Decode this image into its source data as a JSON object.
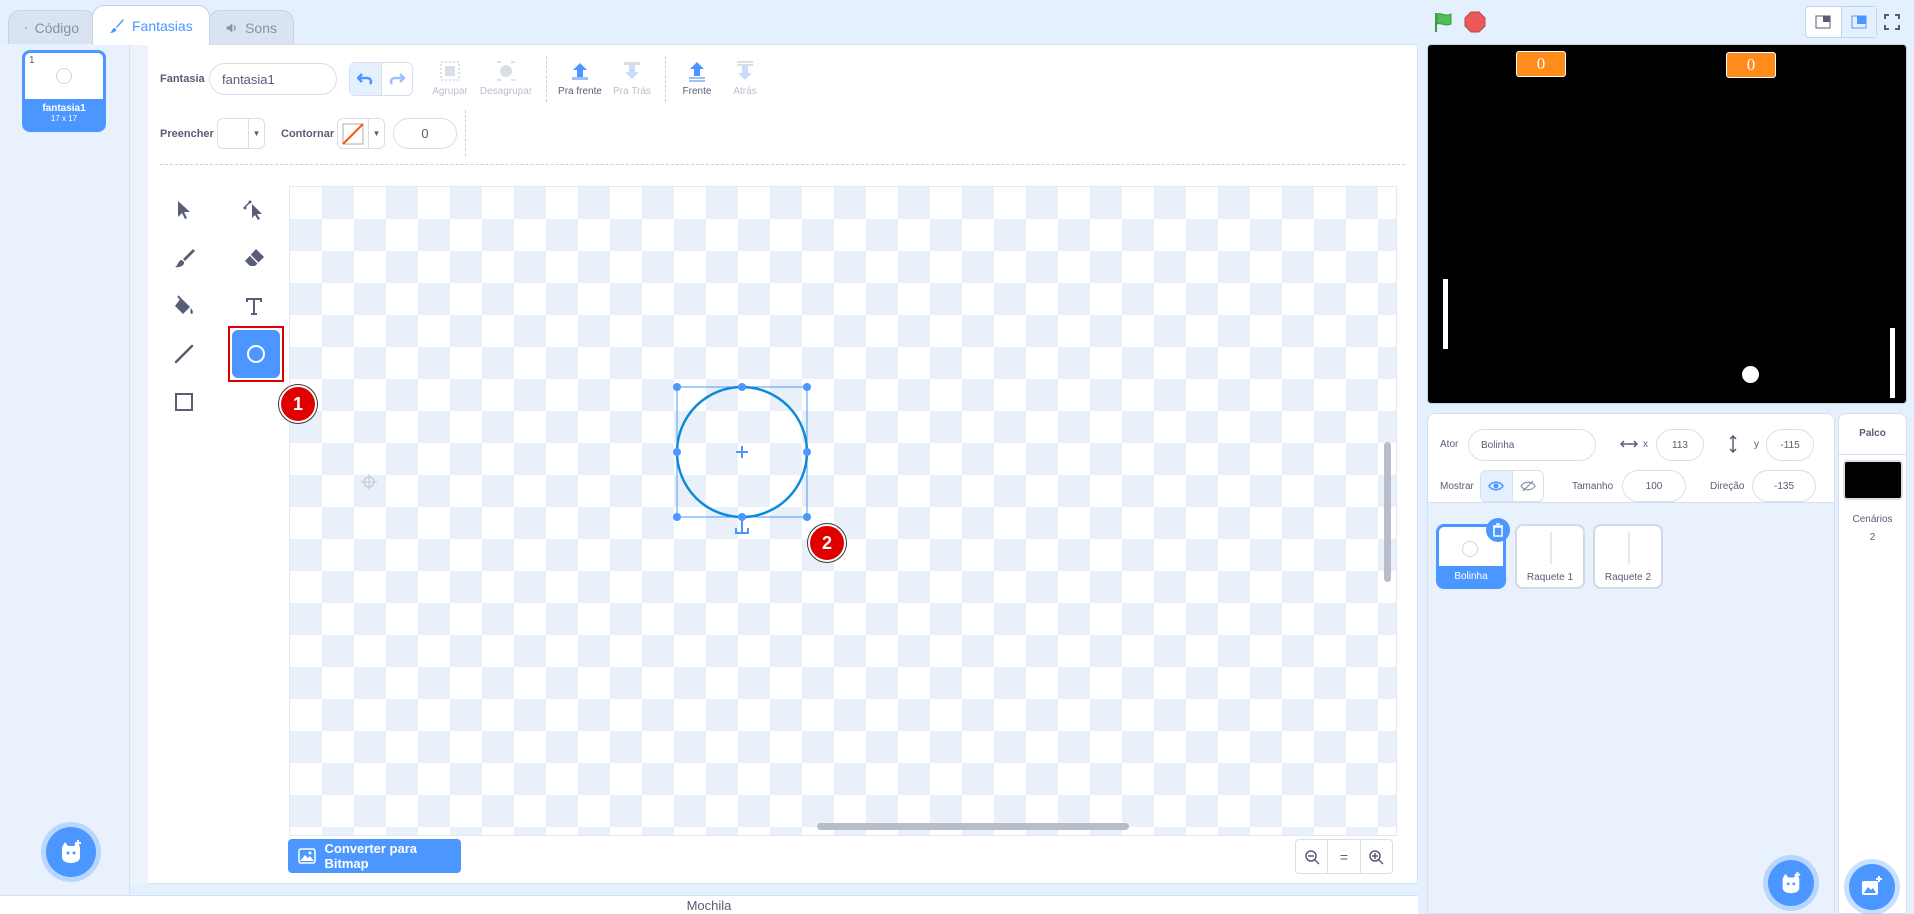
{
  "tabs": {
    "code": "Código",
    "costumes": "Fantasias",
    "sounds": "Sons"
  },
  "costume_list": {
    "items": [
      {
        "number": "1",
        "name": "fantasia1",
        "size": "17 x 17"
      }
    ]
  },
  "toolbar": {
    "costume_label": "Fantasia",
    "costume_name": "fantasia1",
    "group": "Agrupar",
    "ungroup": "Desagrupar",
    "forward": "Pra frente",
    "backward": "Pra Trás",
    "front": "Frente",
    "back": "Atrás",
    "fill_label": "Preencher",
    "outline_label": "Contornar",
    "outline_width": "0"
  },
  "tools": {
    "selected": "circle"
  },
  "markers": {
    "m1": "1",
    "m2": "2"
  },
  "canvas": {
    "convert_button": "Converter para Bitmap",
    "zoom_reset": "="
  },
  "backpack": "Mochila",
  "stage": {
    "score_left": "0",
    "score_right": "0"
  },
  "sprite_info": {
    "sprite_label": "Ator",
    "sprite_name": "Bolinha",
    "x_label": "x",
    "x_value": "113",
    "y_label": "y",
    "y_value": "-115",
    "show_label": "Mostrar",
    "size_label": "Tamanho",
    "size_value": "100",
    "direction_label": "Direção",
    "direction_value": "-135"
  },
  "sprites": [
    {
      "name": "Bolinha"
    },
    {
      "name": "Raquete 1"
    },
    {
      "name": "Raquete 2"
    }
  ],
  "stage_panel": {
    "title": "Palco",
    "backdrops_label": "Cenários",
    "backdrops_count": "2"
  },
  "colors": {
    "accent": "#4c97ff",
    "score": "#ff8c1a",
    "marker": "#e10000",
    "flag": "#4cbf56",
    "stop": "#ec5959"
  }
}
